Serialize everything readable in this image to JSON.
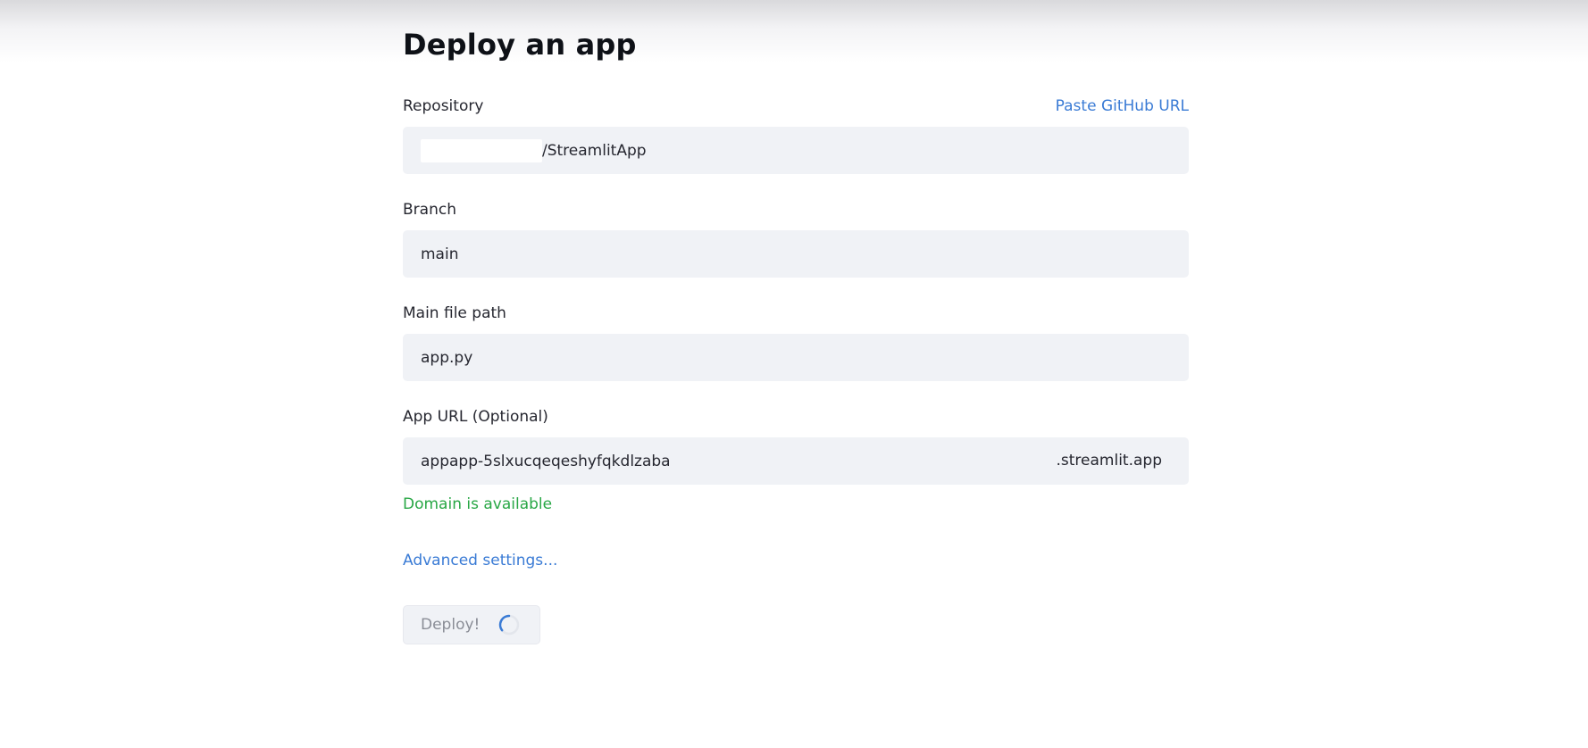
{
  "page": {
    "title": "Deploy an app"
  },
  "repository": {
    "label": "Repository",
    "paste_link": "Paste GitHub URL",
    "value": "/StreamlitApp"
  },
  "branch": {
    "label": "Branch",
    "value": "main"
  },
  "main_file": {
    "label": "Main file path",
    "value": "app.py"
  },
  "app_url": {
    "label": "App URL (Optional)",
    "value": "appapp-5slxucqeqeshyfqkdlzaba",
    "suffix": ".streamlit.app",
    "status": "Domain is available"
  },
  "advanced": {
    "label": "Advanced settings..."
  },
  "deploy": {
    "label": "Deploy!",
    "state": "loading"
  },
  "colors": {
    "link": "#3a7bd5",
    "success": "#28a745",
    "input_bg": "#f0f2f6",
    "spinner": "#3a7bd5"
  },
  "icons": {
    "spinner": "loading-spinner-icon"
  }
}
